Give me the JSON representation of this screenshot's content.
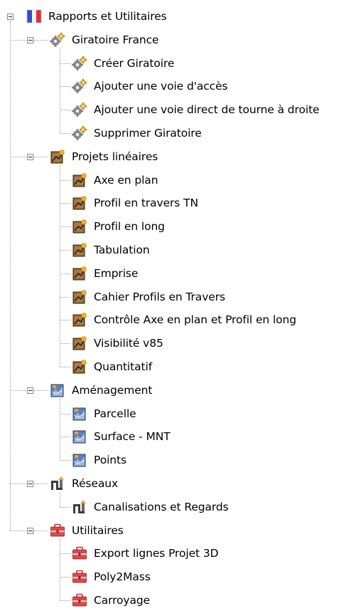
{
  "tree": {
    "root": {
      "label": "Rapports et Utilitaires",
      "icon": "french-flag-icon",
      "expanded": true,
      "groups": [
        {
          "label": "Giratoire France",
          "icon": "gears-icon",
          "expanded": true,
          "items": [
            {
              "label": "Créer Giratoire",
              "icon": "gears-icon"
            },
            {
              "label": "Ajouter une voie d'accès",
              "icon": "gears-icon"
            },
            {
              "label": "Ajouter une voie direct de tourne à droite",
              "icon": "gears-icon"
            },
            {
              "label": "Supprimer Giratoire",
              "icon": "gears-icon"
            }
          ]
        },
        {
          "label": "Projets linéaires",
          "icon": "linear-project-icon",
          "expanded": true,
          "items": [
            {
              "label": "Axe en plan",
              "icon": "linear-project-icon"
            },
            {
              "label": "Profil en travers TN",
              "icon": "linear-project-icon"
            },
            {
              "label": "Profil en long",
              "icon": "linear-project-icon"
            },
            {
              "label": "Tabulation",
              "icon": "linear-project-icon"
            },
            {
              "label": "Emprise",
              "icon": "linear-project-icon"
            },
            {
              "label": "Cahier Profils en Travers",
              "icon": "linear-project-icon"
            },
            {
              "label": "Contrôle Axe en plan et Profil en long",
              "icon": "linear-project-icon"
            },
            {
              "label": "Visibilité v85",
              "icon": "linear-project-icon"
            },
            {
              "label": "Quantitatif",
              "icon": "linear-project-icon"
            }
          ]
        },
        {
          "label": "Aménagement",
          "icon": "terrain-icon",
          "expanded": true,
          "items": [
            {
              "label": "Parcelle",
              "icon": "terrain-icon"
            },
            {
              "label": "Surface - MNT",
              "icon": "terrain-icon"
            },
            {
              "label": "Points",
              "icon": "terrain-icon"
            }
          ]
        },
        {
          "label": "Réseaux",
          "icon": "network-pipes-icon",
          "expanded": true,
          "items": [
            {
              "label": "Canalisations et Regards",
              "icon": "network-pipes-icon"
            }
          ]
        },
        {
          "label": "Utilitaires",
          "icon": "toolbox-icon",
          "expanded": true,
          "items": [
            {
              "label": "Export lignes Projet 3D",
              "icon": "toolbox-icon"
            },
            {
              "label": "Poly2Mass",
              "icon": "toolbox-icon"
            },
            {
              "label": "Carroyage",
              "icon": "toolbox-icon"
            }
          ]
        }
      ]
    }
  }
}
